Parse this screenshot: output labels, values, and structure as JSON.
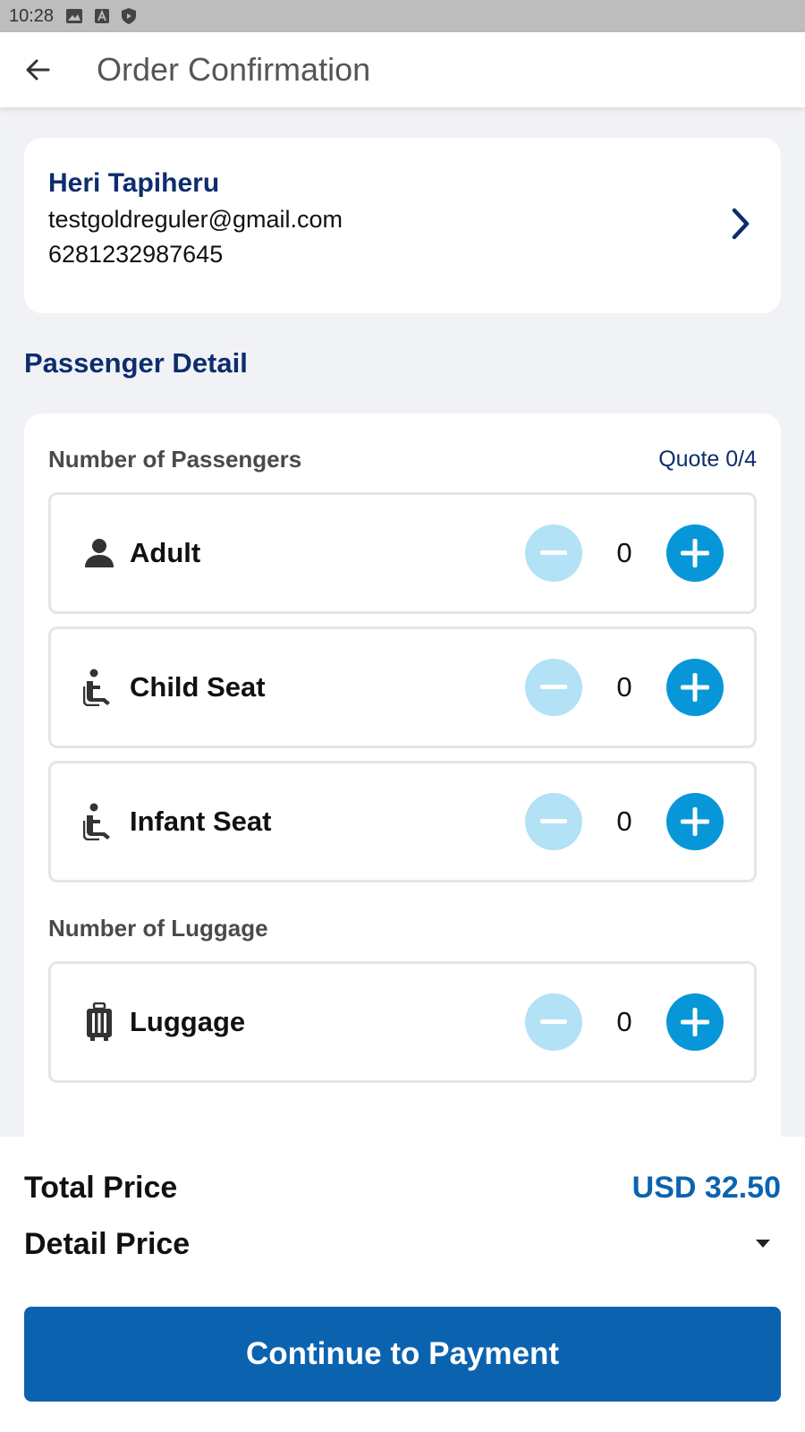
{
  "status_bar": {
    "time": "10:28",
    "icons": [
      "image-icon",
      "text-a-icon",
      "shield-icon"
    ]
  },
  "app_bar": {
    "title": "Order Confirmation",
    "back_icon": "arrow-back-icon"
  },
  "contact": {
    "name": "Heri Tapiheru",
    "email": "testgoldreguler@gmail.com",
    "phone": "6281232987645",
    "chevron_icon": "chevron-right-icon"
  },
  "passenger_section": {
    "title": "Passenger Detail",
    "passengers_label": "Number of Passengers",
    "quote": "Quote 0/4",
    "counters": [
      {
        "label": "Adult",
        "value": "0",
        "icon": "person-icon"
      },
      {
        "label": "Child Seat",
        "value": "0",
        "icon": "seat-icon"
      },
      {
        "label": "Infant Seat",
        "value": "0",
        "icon": "seat-icon"
      }
    ],
    "luggage_label": "Number of Luggage",
    "luggage": {
      "label": "Luggage",
      "value": "0",
      "icon": "luggage-icon"
    }
  },
  "footer": {
    "total_label": "Total Price",
    "total_value": "USD 32.50",
    "detail_label": "Detail Price",
    "pay_button": "Continue to Payment"
  },
  "colors": {
    "primary": "#0b63b0",
    "navy_text": "#0d2d6c",
    "plus_button": "#0797d9",
    "minus_button_disabled": "#b3e1f5",
    "background": "#f1f2f6"
  }
}
